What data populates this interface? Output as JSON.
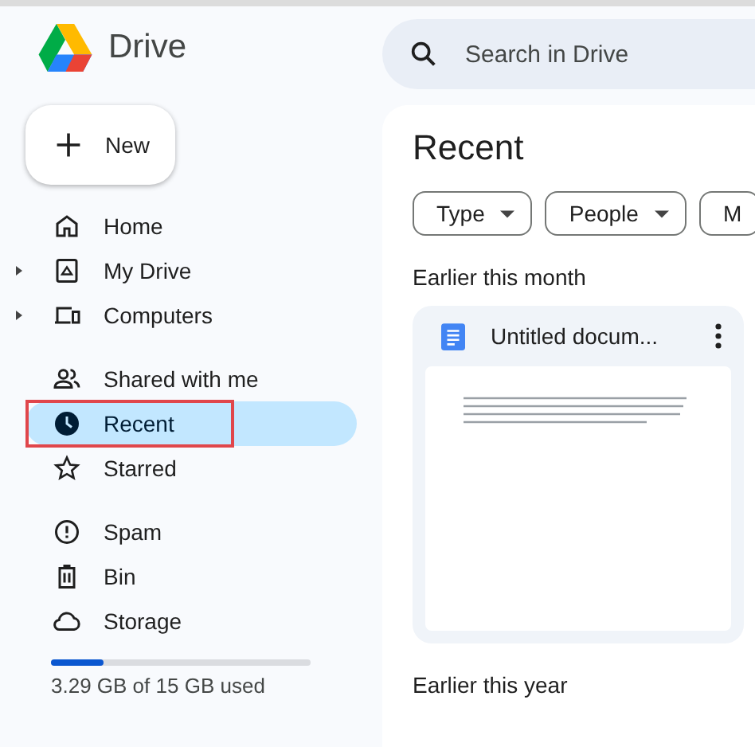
{
  "app": {
    "name": "Drive"
  },
  "new_button": {
    "label": "New"
  },
  "nav_groups": [
    {
      "items": [
        {
          "label": "Home",
          "expandable": false,
          "selected": false
        },
        {
          "label": "My Drive",
          "expandable": true,
          "selected": false
        },
        {
          "label": "Computers",
          "expandable": true,
          "selected": false
        }
      ]
    },
    {
      "items": [
        {
          "label": "Shared with me",
          "expandable": false,
          "selected": false
        },
        {
          "label": "Recent",
          "expandable": false,
          "selected": true,
          "highlighted": true
        },
        {
          "label": "Starred",
          "expandable": false,
          "selected": false
        }
      ]
    },
    {
      "items": [
        {
          "label": "Spam",
          "expandable": false,
          "selected": false
        },
        {
          "label": "Bin",
          "expandable": false,
          "selected": false
        },
        {
          "label": "Storage",
          "expandable": false,
          "selected": false
        }
      ]
    }
  ],
  "storage": {
    "level": 0.2,
    "text": "3.29 GB of 15 GB used"
  },
  "search": {
    "placeholder": "Search in Drive"
  },
  "page_title": "Recent",
  "filters": [
    "Type",
    "People",
    "M"
  ],
  "sections": [
    {
      "heading": "Earlier this month",
      "files": [
        {
          "name": "Untitled docum..."
        }
      ]
    },
    {
      "heading": "Earlier this year"
    }
  ]
}
